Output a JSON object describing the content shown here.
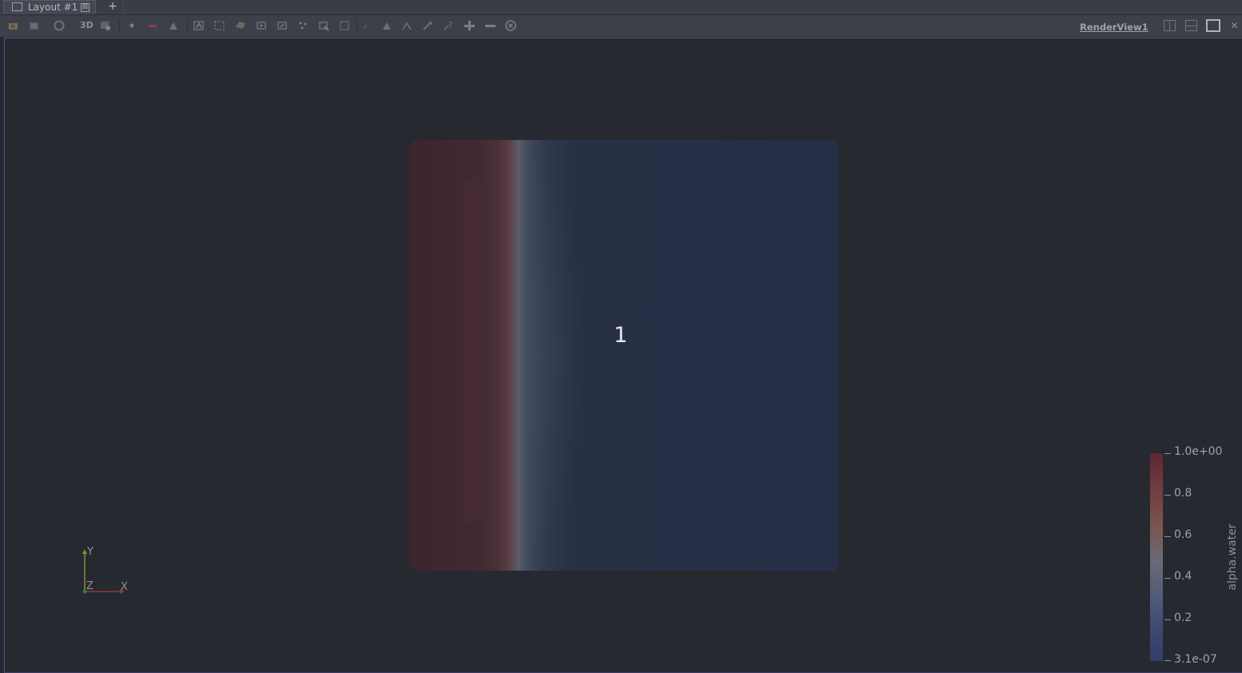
{
  "tabs": {
    "active_label": "Layout #1",
    "close_glyph": "⊠",
    "add_label": "+"
  },
  "toolbar": {
    "mode_3d_label": "3D",
    "view_title": "RenderView1",
    "icons": [
      "reset-camera-icon",
      "zoom-to-data-icon",
      "zoom-to-box-icon",
      "toggle-3d-icon",
      "capture-screenshot-icon",
      "interaction-mode-icon",
      "select-cells-on-icon",
      "select-points-on-icon",
      "select-cells-frustum-icon",
      "select-points-frustum-icon",
      "select-polygon-cells-icon",
      "select-polygon-points-icon",
      "interactive-select-cells-icon",
      "interactive-select-points-icon",
      "hover-cells-icon",
      "hover-points-icon",
      "select-block-icon",
      "grow-selection-icon",
      "shrink-selection-icon",
      "clear-selection-icon"
    ],
    "view_controls": [
      "split-horizontal-icon",
      "split-vertical-icon",
      "maximize-icon",
      "close-view-icon"
    ],
    "close_glyph": "✕"
  },
  "render_view": {
    "block_label": "1",
    "axes": {
      "y": "Y",
      "z": "Z",
      "x": "X"
    }
  },
  "colorbar": {
    "title": "alpha.water",
    "labels": [
      "1.0e+00",
      "0.8",
      "0.6",
      "0.4",
      "0.2",
      "3.1e-07"
    ],
    "range": [
      3.1e-07,
      1.0
    ],
    "colors": {
      "high": "#5e2733",
      "mid": "#6a6a78",
      "low": "#333d68"
    }
  }
}
